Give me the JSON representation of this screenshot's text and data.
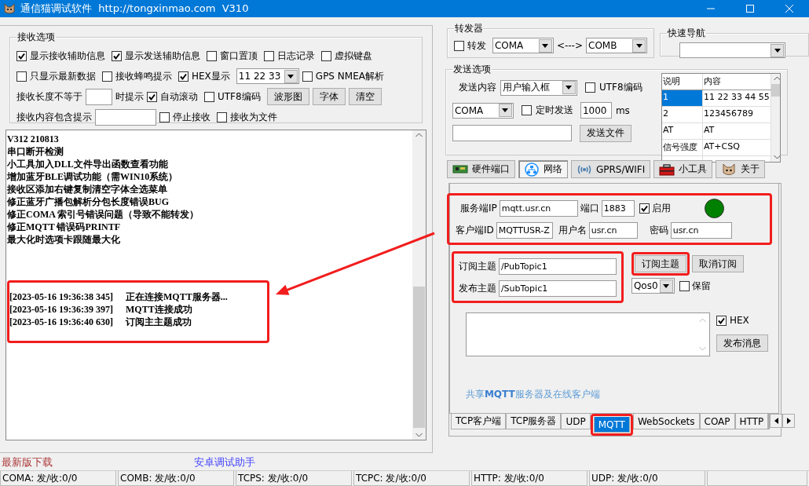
{
  "window": {
    "title": "通信猫调试软件  http://tongxinmao.com  V310"
  },
  "receive_options": {
    "title": "接收选项",
    "rows": [
      {
        "items": [
          {
            "kind": "checkbox",
            "label": "显示接收辅助信息",
            "checked": true
          },
          {
            "kind": "checkbox",
            "label": "显示发送辅助信息",
            "checked": true
          },
          {
            "kind": "checkbox",
            "label": "窗口置顶",
            "checked": false
          },
          {
            "kind": "checkbox",
            "label": "日志记录",
            "checked": false
          },
          {
            "kind": "checkbox",
            "label": "虚拟键盘",
            "checked": false
          }
        ]
      },
      {
        "items": [
          {
            "kind": "checkbox",
            "label": "只显示最新数据",
            "checked": false
          },
          {
            "kind": "checkbox",
            "label": "接收蜂鸣提示",
            "checked": false
          },
          {
            "kind": "checkbox",
            "label": "HEX显示",
            "checked": true
          },
          {
            "kind": "combo",
            "value": "11 22 33"
          },
          {
            "kind": "checkbox",
            "label": "GPS NMEA解析",
            "checked": false
          }
        ]
      },
      {
        "items": [
          {
            "kind": "text",
            "text": "接收长度不等于"
          },
          {
            "kind": "input"
          },
          {
            "kind": "text",
            "text": "时提示"
          },
          {
            "kind": "checkbox",
            "label": "自动滚动",
            "checked": true
          },
          {
            "kind": "checkbox",
            "label": "UTF8编码",
            "checked": false
          },
          {
            "kind": "button",
            "label": "波形图"
          },
          {
            "kind": "button",
            "label": "字体"
          },
          {
            "kind": "button",
            "label": "清空"
          }
        ]
      },
      {
        "items": [
          {
            "kind": "text",
            "text": "接收内容包含提示"
          },
          {
            "kind": "input"
          },
          {
            "kind": "checkbox",
            "label": "停止接收",
            "checked": false
          },
          {
            "kind": "checkbox",
            "label": "接收为文件",
            "checked": false
          }
        ]
      }
    ]
  },
  "receive_log": {
    "lines": [
      "V312 210813",
      "串口断开检测",
      "小工具加入DLL文件导出函数查看功能",
      "增加蓝牙BLE调试功能（需WIN10系统）",
      "接收区添加右键复制清空字体全选菜单",
      "修正蓝牙广播包解析分包长度错误BUG",
      "修正COMA 索引号错误问题（导致不能转发）",
      "修正MQTT 错误码PRINTF",
      "最大化时选项卡跟随最大化"
    ],
    "entries": [
      {
        "time": "[2023-05-16 19:36:38 345]",
        "message": "正在连接MQTT服务器..."
      },
      {
        "time": "[2023-05-16 19:36:39 397]",
        "message": "MQTT连接成功"
      },
      {
        "time": "[2023-05-16 19:36:40 630]",
        "message": "订阅主主题成功"
      }
    ]
  },
  "footer": {
    "download_link": "最新版下载",
    "android_link": "安卓调试助手"
  },
  "forwarder": {
    "title": "转发器",
    "enable": {
      "label": "转发",
      "checked": false
    },
    "port_a": "COMA",
    "separator": "<--->",
    "port_b": "COMB"
  },
  "quick_nav": {
    "title": "快速导航"
  },
  "send_options": {
    "title": "发送选项",
    "content_label": "发送内容",
    "content_source": "用户输入框",
    "utf8": {
      "label": "UTF8编码",
      "checked": false
    },
    "port": "COMA",
    "timed": {
      "label": "定时发送",
      "checked": false
    },
    "interval": "1000",
    "interval_unit": "ms",
    "send_file_button": "发送文件",
    "table": {
      "columns": [
        "说明",
        "内容"
      ],
      "rows": [
        {
          "cells": [
            "1",
            "11 22 33 44 55"
          ],
          "selected": true
        },
        {
          "cells": [
            "2",
            "123456789"
          ],
          "selected": false
        },
        {
          "cells": [
            "AT",
            "AT"
          ],
          "selected": false
        },
        {
          "cells": [
            "信号强度",
            "AT+CSQ"
          ],
          "selected": false
        }
      ]
    }
  },
  "mode_tabs": [
    {
      "label": "硬件端口",
      "selected": false
    },
    {
      "label": "网络",
      "selected": true
    },
    {
      "label": "GPRS/WIFI",
      "selected": false
    },
    {
      "label": "小工具",
      "selected": false
    },
    {
      "label": "关于",
      "selected": false
    }
  ],
  "mqtt": {
    "server_label": "服务端IP",
    "server": "mqtt.usr.cn",
    "port_label": "端口",
    "port": "1883",
    "enable": {
      "label": "启用",
      "checked": true
    },
    "connected": true,
    "client_id_label": "客户端ID",
    "client_id": "MQTTUSR-Z",
    "username_label": "用户名",
    "username": "usr.cn",
    "password_label": "密码",
    "password": "usr.cn",
    "subscribe_label": "订阅主题",
    "subscribe_topic": "/PubTopic1",
    "subscribe_button": "订阅主题",
    "unsubscribe_button": "取消订阅",
    "publish_label": "发布主题",
    "publish_topic": "/SubTopic1",
    "qos": "Qos0",
    "retain": {
      "label": "保留",
      "checked": false
    },
    "hex": {
      "label": "HEX",
      "checked": true
    },
    "publish_button": "发布消息",
    "share_link": "共享**MQTT**服务器及在线客户端"
  },
  "protocol_tabs": [
    {
      "label": "TCP客户端",
      "selected": false
    },
    {
      "label": "TCP服务器",
      "selected": false
    },
    {
      "label": "UDP",
      "selected": false
    },
    {
      "label": "MQTT",
      "selected": true
    },
    {
      "label": "WebSockets",
      "selected": false
    },
    {
      "label": "COAP",
      "selected": false
    },
    {
      "label": "HTTP",
      "selected": false
    }
  ],
  "status_bar": [
    "COMA: 发/收:0/0",
    "COMB: 发/收:0/0",
    "TCPS: 发/收:0/0",
    "TCPC: 发/收:0/0",
    "HTTP: 发/收:0/0",
    "UDP: 发/收:0/0"
  ]
}
